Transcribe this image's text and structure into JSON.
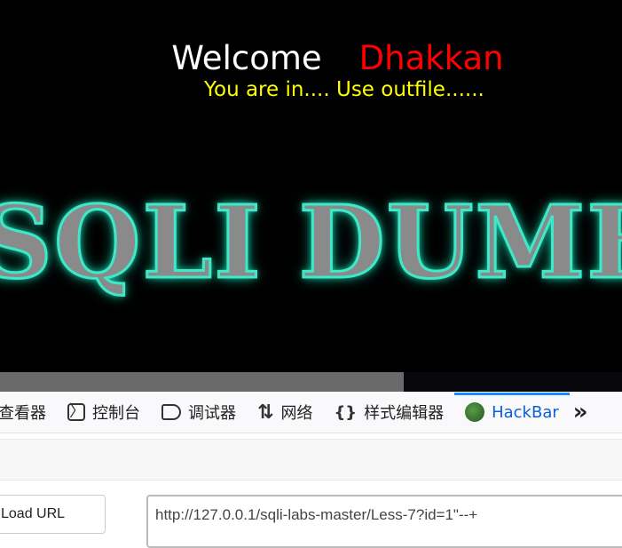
{
  "page": {
    "welcome": "Welcome",
    "name": "Dhakkan",
    "message": "You are in.... Use outfile......",
    "logo": "SQLI DUMB"
  },
  "devtools": {
    "tabs": [
      {
        "label": "查看器",
        "icon": "inspector-icon"
      },
      {
        "label": "控制台",
        "icon": "console-icon"
      },
      {
        "label": "调试器",
        "icon": "debugger-icon"
      },
      {
        "label": "网络",
        "icon": "network-icon"
      },
      {
        "label": "样式编辑器",
        "icon": "style-editor-icon"
      },
      {
        "label": "HackBar",
        "icon": "hackbar-icon",
        "active": true
      }
    ],
    "more": "»"
  },
  "hackbar": {
    "load_url": "Load URL",
    "url": "http://127.0.0.1/sqli-labs-master/Less-7?id=1\"--+"
  },
  "colors": {
    "accent": "#1a8cff",
    "welcome_name": "#ff0000",
    "message": "#ffff00"
  }
}
